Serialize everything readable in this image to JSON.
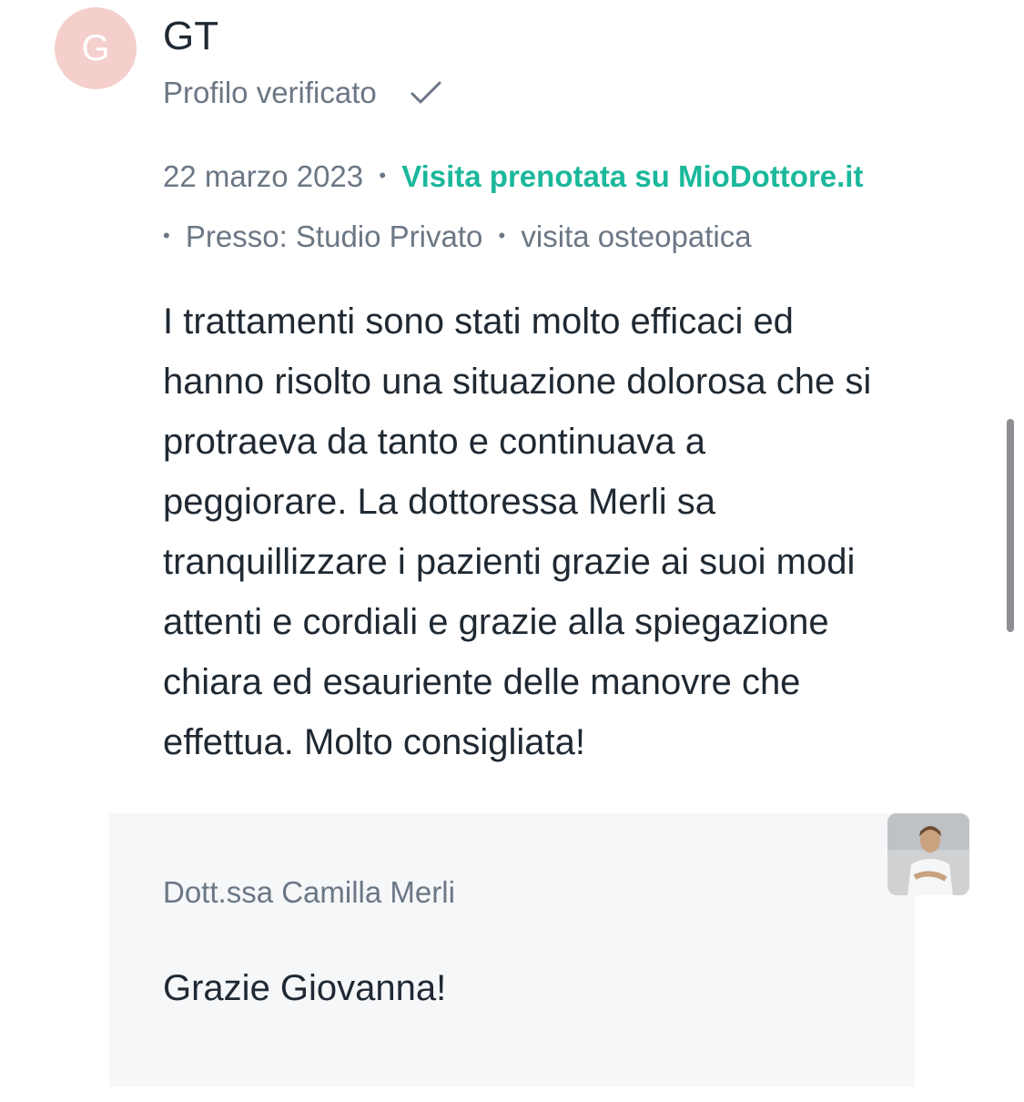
{
  "review": {
    "avatar_initial": "G",
    "author": "GT",
    "verified_label": "Profilo verificato",
    "date": "22 marzo 2023",
    "booked_label": "Visita prenotata su MioDottore.it",
    "location": "Presso: Studio Privato",
    "service": "visita osteopatica",
    "text": "I trattamenti sono stati molto efficaci ed\nhanno risolto una situazione dolorosa che si\nprotraeva da tanto e continuava a\npeggiorare. La dottoressa Merli sa\ntranquillizzare i pazienti grazie ai suoi modi\nattenti e cordiali e grazie alla spiegazione\nchiara ed esauriente delle manovre che\neffettua. Molto consigliata!"
  },
  "reply": {
    "author": "Dott.ssa Camilla Merli",
    "text": "Grazie Giovanna!"
  },
  "icons": {
    "verified": "check-icon",
    "doctor": "doctor-photo"
  },
  "colors": {
    "avatar_bg": "#f5cfcc",
    "accent_green": "#1bb89b",
    "muted_text": "#6b7785",
    "body_text": "#1f2933",
    "reply_bg": "#f5f7f9"
  }
}
